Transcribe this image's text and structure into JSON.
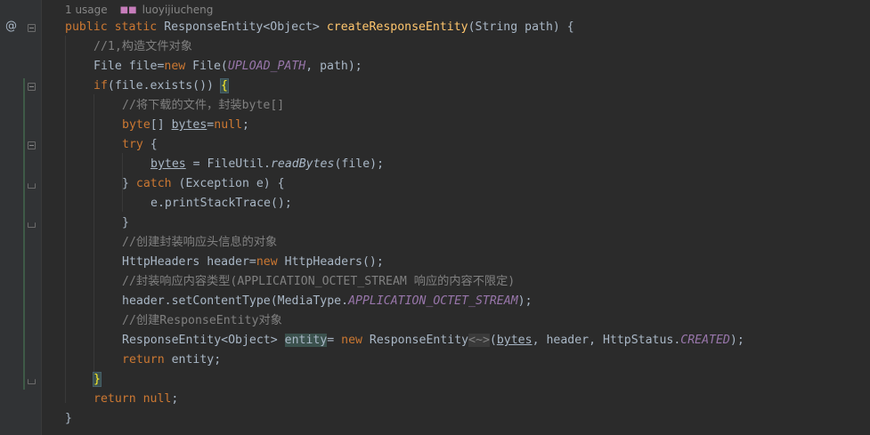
{
  "hint": {
    "usage": "1 usage",
    "author": "luoyijiucheng"
  },
  "gutter": {
    "override_marker": "@"
  },
  "code": {
    "l1": {
      "kw1": "public",
      "kw2": "static",
      "type": "ResponseEntity<Object>",
      "fn": "createResponseEntity",
      "params": "(String path) {"
    },
    "l2": {
      "comment": "//1,构造文件对象"
    },
    "l3": {
      "a": "File file=",
      "kw": "new",
      "b": " File(",
      "const": "UPLOAD_PATH",
      "c": ", path);"
    },
    "l4": {
      "kw": "if",
      "a": "(file.exists()) ",
      "brace": "{"
    },
    "l5": {
      "comment": "//将下载的文件，封装byte[]"
    },
    "l6": {
      "kw": "byte",
      "a": "[] ",
      "var": "bytes",
      "b": "=",
      "kw2": "null",
      "c": ";"
    },
    "l7": {
      "kw": "try",
      "a": " {"
    },
    "l8": {
      "var": "bytes",
      "a": " = FileUtil.",
      "call": "readBytes",
      "b": "(file);"
    },
    "l9": {
      "a": "} ",
      "kw": "catch",
      "b": " (Exception e) {"
    },
    "l10": {
      "a": "e.printStackTrace();"
    },
    "l11": {
      "a": "}"
    },
    "l12": {
      "comment": "//创建封装响应头信息的对象"
    },
    "l13": {
      "a": "HttpHeaders header=",
      "kw": "new",
      "b": " HttpHeaders();"
    },
    "l14": {
      "comment": "//封装响应内容类型(APPLICATION_OCTET_STREAM 响应的内容不限定)"
    },
    "l15": {
      "a": "header.setContentType(MediaType.",
      "const": "APPLICATION_OCTET_STREAM",
      "b": ");"
    },
    "l16": {
      "comment": "//创建ResponseEntity对象"
    },
    "l17": {
      "a": "ResponseEntity<Object> ",
      "var": "entity",
      "b": "= ",
      "kw": "new",
      "c": " ResponseEntity",
      "diamond": "<~>",
      "d": "(",
      "var2": "bytes",
      "e": ", header, HttpStatus.",
      "const": "CREATED",
      "f": ");"
    },
    "l18": {
      "kw": "return",
      "a": " entity;"
    },
    "l19": {
      "brace": "}"
    },
    "l20": {
      "kw": "return",
      "kw2": "null",
      "a": ";"
    },
    "l21": {
      "a": "}"
    }
  }
}
